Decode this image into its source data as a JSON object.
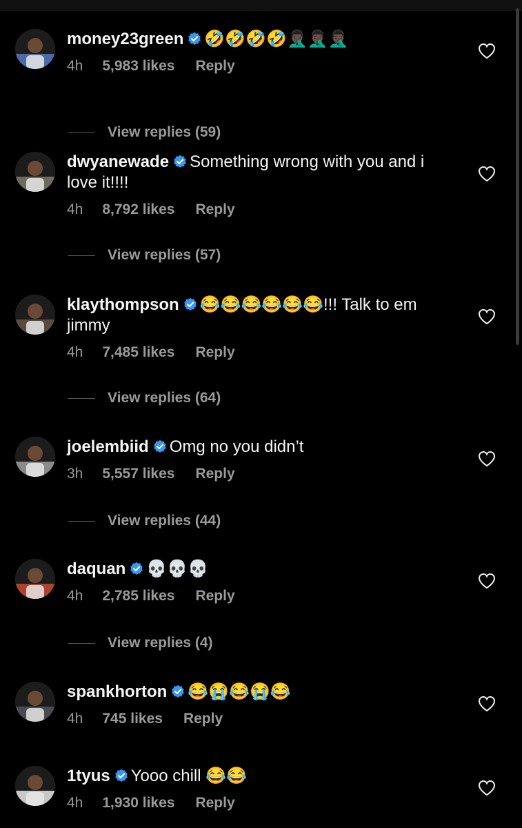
{
  "comments": [
    {
      "username": "money23green",
      "text": "🤣🤣🤣🤣🤦🏿‍♂️🤦🏿‍♂️🤦🏿‍♂️",
      "time": "4h",
      "likes": "5,983 likes",
      "reply": "Reply",
      "view_replies": "View replies (59)",
      "avatar_color": "#4a6aa8"
    },
    {
      "username": "dwyanewade",
      "text": "Something wrong with you and i love it!!!!",
      "time": "4h",
      "likes": "8,792 likes",
      "reply": "Reply",
      "view_replies": "View replies (57)",
      "avatar_color": "#6d6a60"
    },
    {
      "username": "klaythompson",
      "text": "😂😂😂😂😂😂!!! Talk to em jimmy",
      "time": "4h",
      "likes": "7,485 likes",
      "reply": "Reply",
      "view_replies": "View replies (64)",
      "avatar_color": "#5a4a40"
    },
    {
      "username": "joelembiid",
      "text": "Omg no you didn’t",
      "time": "3h",
      "likes": "5,557 likes",
      "reply": "Reply",
      "view_replies": "View replies (44)",
      "avatar_color": "#8a8a8a"
    },
    {
      "username": "daquan",
      "text": "💀💀💀",
      "time": "4h",
      "likes": "2,785 likes",
      "reply": "Reply",
      "view_replies": "View replies (4)",
      "avatar_color": "#b04030"
    },
    {
      "username": "spankhorton",
      "text": "😂😭😂😭😂",
      "time": "4h",
      "likes": "745 likes",
      "reply": "Reply",
      "avatar_color": "#4a4a50"
    },
    {
      "username": "1tyus",
      "text": "Yooo chill 😂😂",
      "time": "4h",
      "likes": "1,930 likes",
      "reply": "Reply",
      "avatar_color": "#c8c8c8"
    }
  ],
  "colors": {
    "background": "#000000",
    "text": "#f5f5f5",
    "secondary": "#9a9a9a",
    "verified": "#3897f0"
  }
}
